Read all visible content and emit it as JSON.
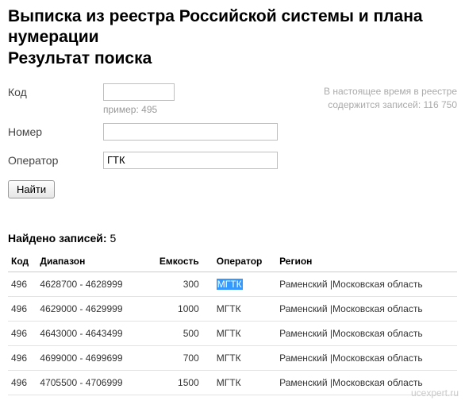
{
  "title_line1": "Выписка из реестра Российской системы и плана нумерации",
  "title_line2": "Результат поиска",
  "form": {
    "code_label": "Код",
    "code_value": "",
    "code_hint": "пример: 495",
    "number_label": "Номер",
    "number_value": "",
    "operator_label": "Оператор",
    "operator_value": "ГТК",
    "submit_label": "Найти"
  },
  "status": {
    "line1": "В настоящее время в реестре",
    "line2": "содержится записей: 116 750"
  },
  "results": {
    "found_label": "Найдено записей:",
    "found_count": "5",
    "headers": {
      "code": "Код",
      "range": "Диапазон",
      "capacity": "Емкость",
      "operator": "Оператор",
      "region": "Регион"
    },
    "rows": [
      {
        "code": "496",
        "range": "4628700 - 4628999",
        "capacity": "300",
        "operator": "МГТК",
        "region": "Раменский |Московская область",
        "highlight": true
      },
      {
        "code": "496",
        "range": "4629000 - 4629999",
        "capacity": "1000",
        "operator": "МГТК",
        "region": "Раменский |Московская область",
        "highlight": false
      },
      {
        "code": "496",
        "range": "4643000 - 4643499",
        "capacity": "500",
        "operator": "МГТК",
        "region": "Раменский |Московская область",
        "highlight": false
      },
      {
        "code": "496",
        "range": "4699000 - 4699699",
        "capacity": "700",
        "operator": "МГТК",
        "region": "Раменский |Московская область",
        "highlight": false
      },
      {
        "code": "496",
        "range": "4705500 - 4706999",
        "capacity": "1500",
        "operator": "МГТК",
        "region": "Раменский |Московская область",
        "highlight": false
      }
    ]
  },
  "watermark": "ucexpert.ru"
}
